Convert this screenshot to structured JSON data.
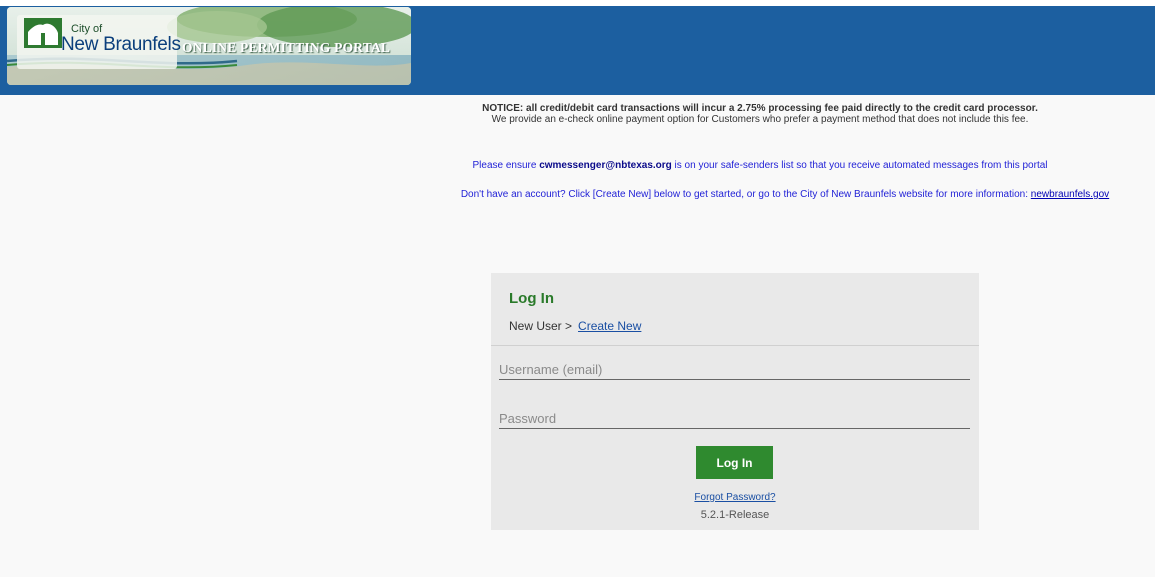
{
  "header": {
    "logo_city": "City of",
    "logo_name": "New Braunfels",
    "logo_portal": "ONLINE PERMITTING PORTAL",
    "background_color": "#1c5fa0"
  },
  "notice": {
    "line1": "NOTICE: all credit/debit card transactions will incur a 2.75% processing fee paid directly to the credit card processor.",
    "line2": "We provide an e-check online payment option for Customers who prefer a payment method that does not include this fee."
  },
  "safe_senders": {
    "prefix": "Please ensure ",
    "email": "cwmessenger@nbtexas.org",
    "suffix": " is on your safe-senders list so that you receive automated messages from this portal"
  },
  "account_info": {
    "text": "Don't have an account? Click [Create New] below to get started, or go to the City of New Braunfels website for more information: ",
    "link": "newbraunfels.gov"
  },
  "login": {
    "title": "Log In",
    "new_user_label": "New User >",
    "create_new_link": "Create New",
    "username_placeholder": "Username (email)",
    "password_placeholder": "Password",
    "button_label": "Log In",
    "forgot_password_link": "Forgot Password?",
    "version": "5.2.1-Release",
    "accent_color": "#2f8a2f"
  }
}
